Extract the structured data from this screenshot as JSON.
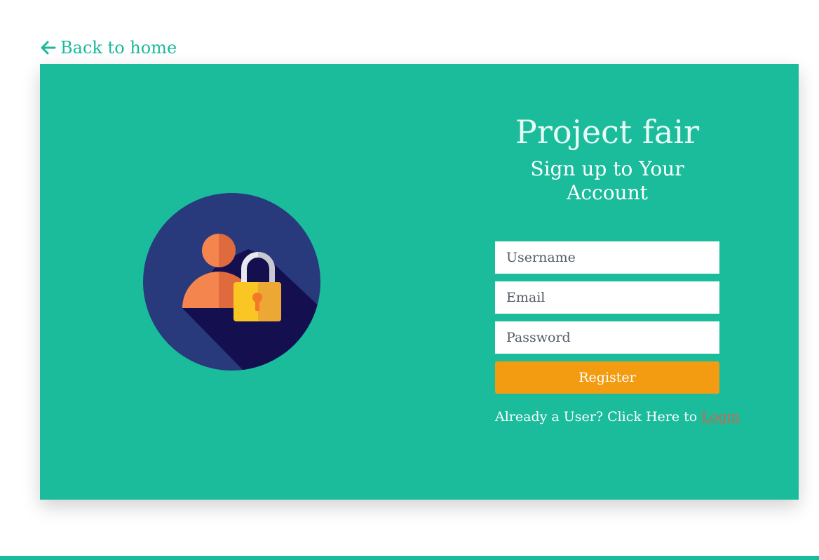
{
  "back_link": {
    "label": "Back to home"
  },
  "header": {
    "title": "Project fair",
    "subtitle": "Sign up to Your Account"
  },
  "form": {
    "username_placeholder": "Username",
    "email_placeholder": "Email",
    "password_placeholder": "Password",
    "register_label": "Register",
    "login_prompt": "Already a User? Click Here to ",
    "login_link": "Login"
  },
  "colors": {
    "accent": "#1abc9c",
    "button": "#f39c12",
    "login_link": "#d9624a"
  },
  "icons": {
    "back": "arrow-left-icon",
    "illustration": "user-lock-icon"
  }
}
